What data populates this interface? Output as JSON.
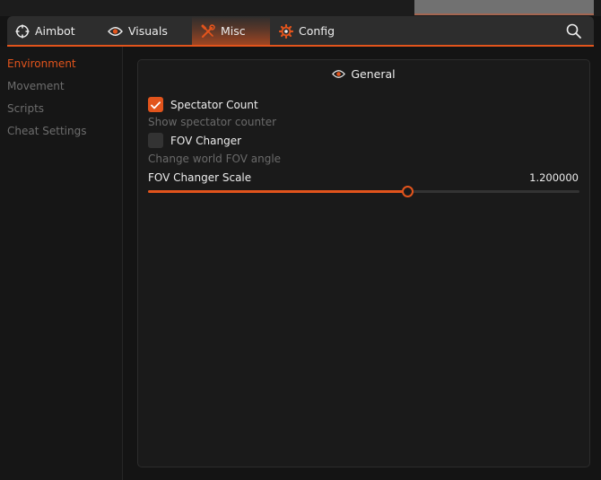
{
  "tabs": [
    {
      "label": "Aimbot",
      "icon": "crosshair-icon"
    },
    {
      "label": "Visuals",
      "icon": "eye-icon"
    },
    {
      "label": "Misc",
      "icon": "wrench-icon",
      "active": true
    },
    {
      "label": "Config",
      "icon": "gear-icon"
    }
  ],
  "search": {
    "icon": "search-icon"
  },
  "sidebar": {
    "items": [
      {
        "label": "Environment",
        "active": true
      },
      {
        "label": "Movement"
      },
      {
        "label": "Scripts"
      },
      {
        "label": "Cheat Settings"
      }
    ]
  },
  "panel": {
    "title": "General",
    "icon": "eye-icon",
    "spectator_count": {
      "label": "Spectator Count",
      "description": "Show spectator counter",
      "checked": true
    },
    "fov_changer": {
      "label": "FOV Changer",
      "description": "Change world FOV angle",
      "checked": false
    },
    "fov_scale": {
      "label": "FOV Changer Scale",
      "value_text": "1.200000",
      "fill_fraction": 0.6
    }
  },
  "colors": {
    "accent": "#e2541c",
    "background": "#141414",
    "panel": "#1a1a1a",
    "tabbar": "#2d2d2d",
    "muted_text": "#6d6d6d"
  }
}
